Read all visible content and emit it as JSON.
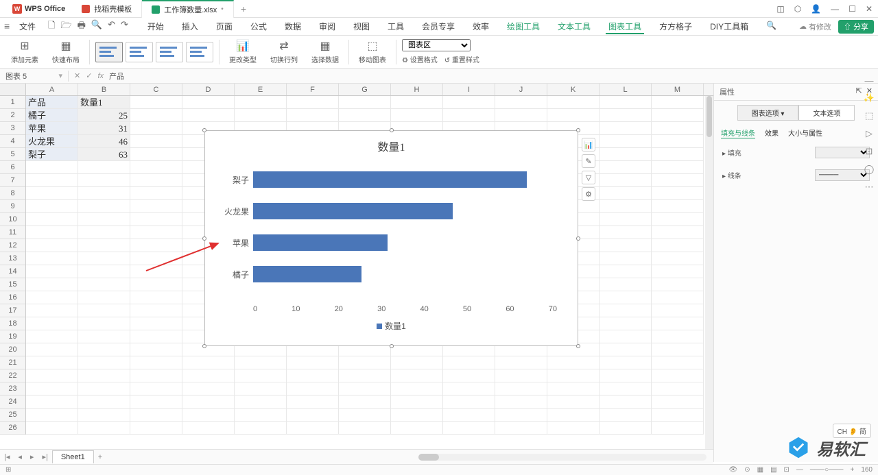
{
  "app": {
    "name": "WPS Office"
  },
  "tabs": [
    {
      "label": "找稻壳模板",
      "icon": "red"
    },
    {
      "label": "工作簿数量.xlsx",
      "icon": "green",
      "active": true
    }
  ],
  "menu": {
    "file": "文件",
    "items": [
      "开始",
      "插入",
      "页面",
      "公式",
      "数据",
      "审阅",
      "视图",
      "工具",
      "会员专享",
      "效率",
      "绘图工具",
      "文本工具",
      "图表工具",
      "方方格子",
      "DIY工具箱"
    ],
    "active": "图表工具",
    "green": [
      "绘图工具",
      "文本工具",
      "图表工具"
    ]
  },
  "topright": {
    "modified": "有修改",
    "share": "分享"
  },
  "ribbon": {
    "add_element": "添加元素",
    "quick_layout": "快速布局",
    "change_type": "更改类型",
    "switch_rowcol": "切换行列",
    "select_data": "选择数据",
    "move_chart": "移动图表",
    "chart_area": "图表区",
    "set_format": "设置格式",
    "reset_style": "重置样式"
  },
  "namebox": "图表 5",
  "formula_val": "产品",
  "sheet": {
    "cols": [
      "A",
      "B",
      "C",
      "D",
      "E",
      "F",
      "G",
      "H",
      "I",
      "J",
      "K",
      "L",
      "M"
    ],
    "rows": 26,
    "data": [
      [
        "产品",
        "数量1"
      ],
      [
        "橘子",
        "25"
      ],
      [
        "苹果",
        "31"
      ],
      [
        "火龙果",
        "46"
      ],
      [
        "梨子",
        "63"
      ]
    ]
  },
  "chart_data": {
    "type": "bar",
    "title": "数量1",
    "categories": [
      "梨子",
      "火龙果",
      "苹果",
      "橘子"
    ],
    "values": [
      63,
      46,
      31,
      25
    ],
    "xlim": [
      0,
      70
    ],
    "xticks": [
      0,
      10,
      20,
      30,
      40,
      50,
      60,
      70
    ],
    "legend": "数量1",
    "series_color": "#4a76b8"
  },
  "panel": {
    "title": "属性",
    "tab_chart": "图表选项",
    "tab_text": "文本选项",
    "sub_fill": "填充与线条",
    "sub_effect": "效果",
    "sub_size": "大小与属性",
    "fill": "填充",
    "line": "线条"
  },
  "sheet_tab": "Sheet1",
  "ime": "CH 👂 简",
  "zoom": "160",
  "watermark": "易软汇"
}
